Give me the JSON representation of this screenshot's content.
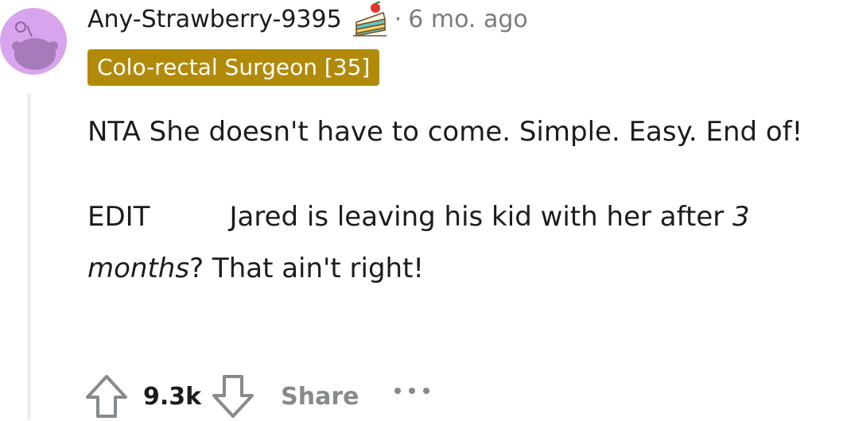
{
  "comment": {
    "author": "Any-Strawberry-9395",
    "separator": "·",
    "timestamp": "6 mo. ago",
    "flair": "Colo-rectal Surgeon [35]",
    "body": {
      "paragraph_1": "NTA She doesn't have to come. Simple. Easy. End of!",
      "edit_label": "EDIT",
      "edit_text_start": "Jared is leaving his kid with her after ",
      "edit_text_emphasis": "3 months",
      "edit_text_end": "? That ain't right!"
    },
    "actions": {
      "score": "9.3k",
      "share_label": "Share"
    }
  },
  "icons": {
    "avatar": "snoo-avatar-icon",
    "cake_day": "cake-day-icon",
    "upvote": "upvote-arrow-icon",
    "downvote": "downvote-arrow-icon",
    "more": "more-options-icon"
  },
  "colors": {
    "avatar_background": "#d9a4ee",
    "flair_background": "#b18a0a",
    "flair_text": "#ffffff",
    "meta_text": "#7c7c7c",
    "body_text": "#1c1c1c",
    "share_text": "#878a8c",
    "thread_line": "#edeff1"
  }
}
